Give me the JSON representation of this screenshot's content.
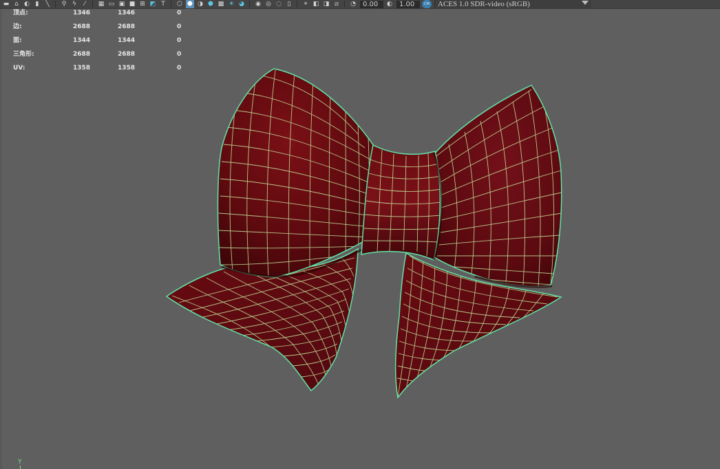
{
  "toolbar": {
    "exposure_value": "0.00",
    "gamma_value": "1.00",
    "color_space": "ACES 1.0 SDR-video (sRGB)",
    "icons": [
      "camera-icon",
      "lock-camera-icon",
      "camera-attributes-icon",
      "bookmark-icon",
      "image-plane-icon",
      "film-gate-icon",
      "resolution-gate-icon",
      "grid-icon",
      "field-chart-icon",
      "safe-action-icon",
      "safe-title-icon",
      "wireframe-icon",
      "smooth-shade-icon",
      "wireframe-on-shaded-icon",
      "default-material-icon",
      "textured-icon",
      "use-all-lights-icon",
      "shadows-icon",
      "ambient-occlusion-icon",
      "motion-blur-icon",
      "anti-aliasing-icon",
      "depth-of-field-icon",
      "isolate-select-icon",
      "xray-icon",
      "xray-joints-icon",
      "backface-culling-icon",
      "exposure-icon",
      "gamma-icon",
      "view-transform-icon"
    ]
  },
  "hud": {
    "rows": [
      {
        "label": "顶点:",
        "v1": "1346",
        "v2": "1346",
        "v3": "0"
      },
      {
        "label": "边:",
        "v1": "2688",
        "v2": "2688",
        "v3": "0"
      },
      {
        "label": "面:",
        "v1": "1344",
        "v2": "1344",
        "v3": "0"
      },
      {
        "label": "三角形:",
        "v1": "2688",
        "v2": "2688",
        "v3": "0"
      },
      {
        "label": "UV:",
        "v1": "1358",
        "v2": "1358",
        "v3": "0"
      }
    ]
  },
  "axis": {
    "y_label": "Y"
  },
  "colors": {
    "viewport_bg": "#5f5f5f",
    "toolbar_bg": "#444444",
    "mesh_fill": "#6b0c12",
    "mesh_dark": "#3d0508",
    "wire": "#c8e8a0",
    "outline": "#5fe6a8",
    "axis_green": "#7fe07f"
  }
}
